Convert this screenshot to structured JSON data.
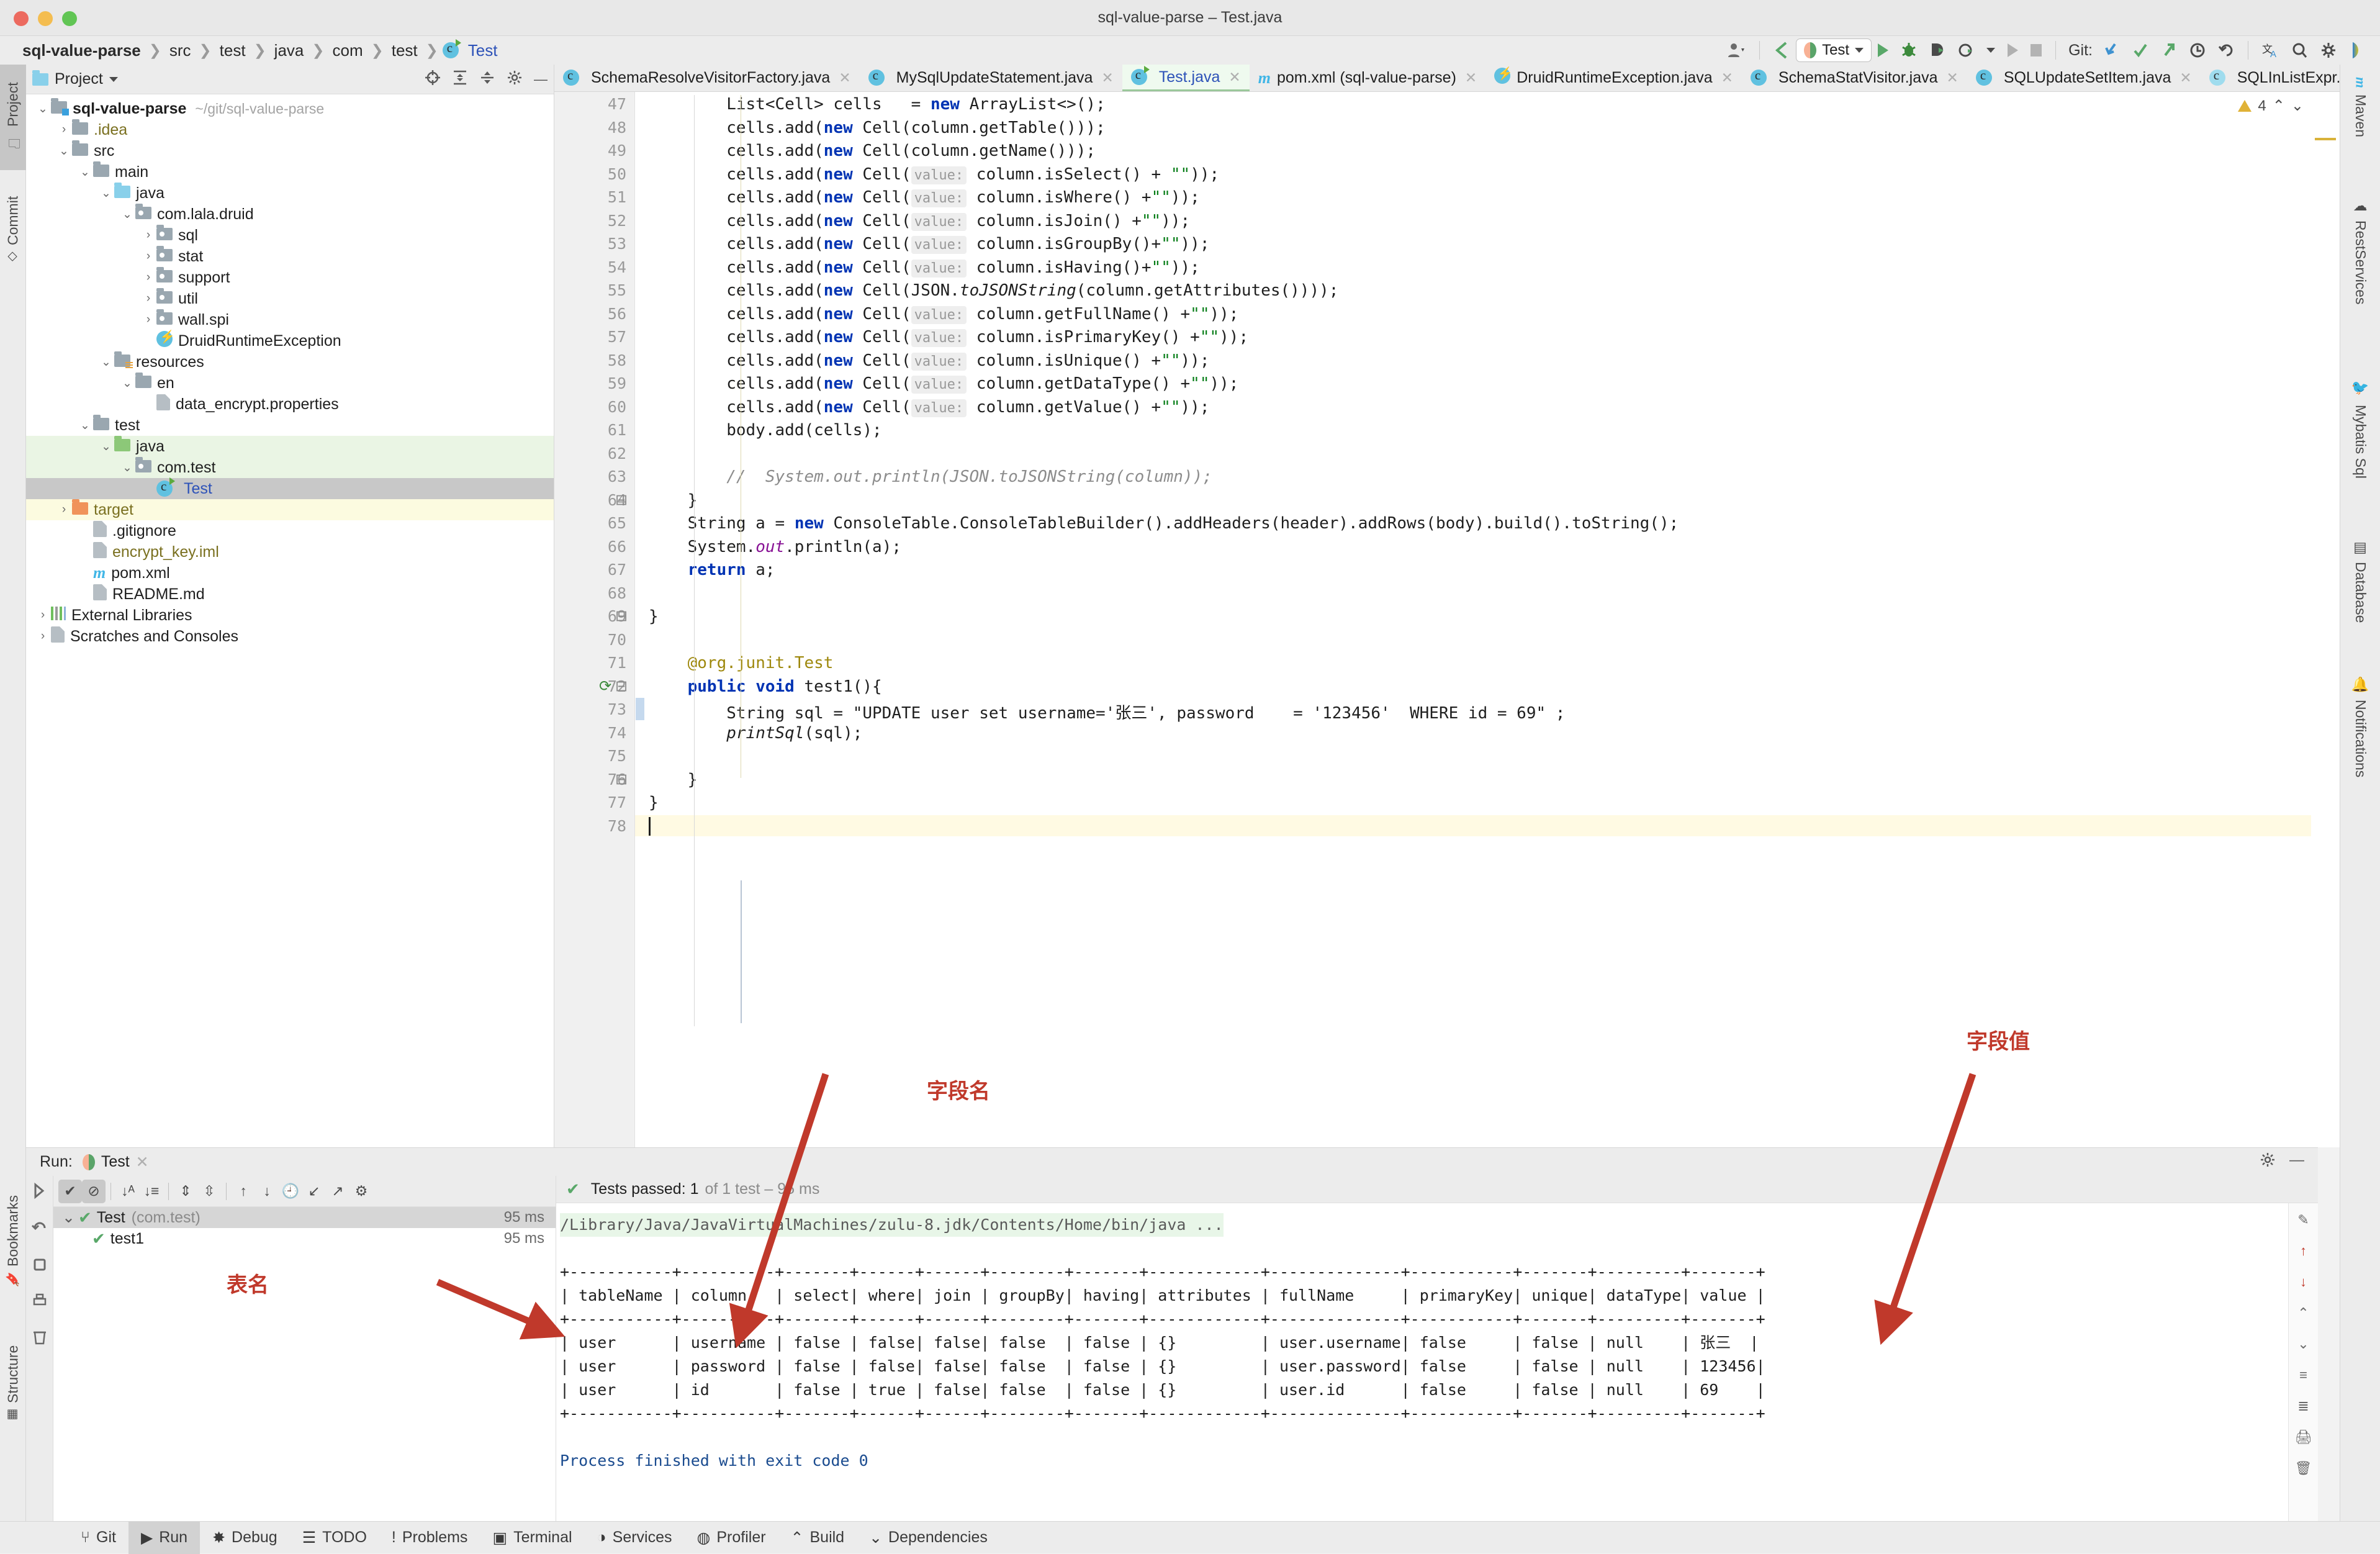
{
  "window": {
    "title": "sql-value-parse – Test.java"
  },
  "breadcrumb": {
    "items": [
      "sql-value-parse",
      "src",
      "test",
      "java",
      "com",
      "test",
      "Test"
    ]
  },
  "toolbar": {
    "run_config": "Test",
    "git_label": "Git:",
    "icons": [
      "profile-icon",
      "back-arrow-icon",
      "run-icon",
      "debug-icon",
      "coverage-icon",
      "profiler-icon",
      "rerun-icon",
      "stop-icon",
      "git-update-icon",
      "git-commit-icon",
      "git-push-icon",
      "git-history-icon",
      "git-rollback-icon",
      "translate-icon",
      "search-icon",
      "settings-icon",
      "ai-icon"
    ]
  },
  "left_tabs": [
    {
      "label": "Project",
      "selected": true
    },
    {
      "label": "Commit",
      "selected": false
    },
    {
      "label": "Bookmarks",
      "selected": false
    },
    {
      "label": "Structure",
      "selected": false
    }
  ],
  "right_tabs": [
    {
      "label": "Maven"
    },
    {
      "label": "RestServices"
    },
    {
      "label": "Mybatis Sql"
    },
    {
      "label": "Database"
    },
    {
      "label": "Notifications"
    }
  ],
  "project_panel": {
    "title": "Project",
    "tree": [
      {
        "indent": 0,
        "arrow": "v",
        "icon": "module-folder",
        "label": "sql-value-parse",
        "bold": true,
        "path": "~/git/sql-value-parse"
      },
      {
        "indent": 1,
        "arrow": ">",
        "icon": "folder",
        "label": ".idea",
        "color": "olive"
      },
      {
        "indent": 1,
        "arrow": "v",
        "icon": "folder",
        "label": "src"
      },
      {
        "indent": 2,
        "arrow": "v",
        "icon": "folder",
        "label": "main"
      },
      {
        "indent": 3,
        "arrow": "v",
        "icon": "folder-blue",
        "label": "java"
      },
      {
        "indent": 4,
        "arrow": "v",
        "icon": "package",
        "label": "com.lala.druid"
      },
      {
        "indent": 5,
        "arrow": ">",
        "icon": "package",
        "label": "sql"
      },
      {
        "indent": 5,
        "arrow": ">",
        "icon": "package",
        "label": "stat"
      },
      {
        "indent": 5,
        "arrow": ">",
        "icon": "package",
        "label": "support"
      },
      {
        "indent": 5,
        "arrow": ">",
        "icon": "package",
        "label": "util"
      },
      {
        "indent": 5,
        "arrow": ">",
        "icon": "package",
        "label": "wall.spi"
      },
      {
        "indent": 5,
        "arrow": "",
        "icon": "bolt",
        "label": "DruidRuntimeException"
      },
      {
        "indent": 3,
        "arrow": "v",
        "icon": "folder-res",
        "label": "resources"
      },
      {
        "indent": 4,
        "arrow": "v",
        "icon": "folder",
        "label": "en"
      },
      {
        "indent": 5,
        "arrow": "",
        "icon": "props-file",
        "label": "data_encrypt.properties"
      },
      {
        "indent": 2,
        "arrow": "v",
        "icon": "folder",
        "label": "test"
      },
      {
        "indent": 3,
        "arrow": "v",
        "icon": "folder-green",
        "label": "java",
        "bg": "green"
      },
      {
        "indent": 4,
        "arrow": "v",
        "icon": "package",
        "label": "com.test",
        "bg": "green"
      },
      {
        "indent": 5,
        "arrow": "",
        "icon": "class-run",
        "label": "Test",
        "color": "blue",
        "bg": "sel"
      },
      {
        "indent": 1,
        "arrow": ">",
        "icon": "folder-orange",
        "label": "target",
        "color": "olive",
        "bg": "yellow"
      },
      {
        "indent": 2,
        "arrow": "",
        "icon": "ignore-file",
        "label": ".gitignore"
      },
      {
        "indent": 2,
        "arrow": "",
        "icon": "iml-file",
        "label": "encrypt_key.iml",
        "color": "olive"
      },
      {
        "indent": 2,
        "arrow": "",
        "icon": "maven-m",
        "label": "pom.xml"
      },
      {
        "indent": 2,
        "arrow": "",
        "icon": "md-file",
        "label": "README.md"
      },
      {
        "indent": 0,
        "arrow": ">",
        "icon": "libraries",
        "label": "External Libraries"
      },
      {
        "indent": 0,
        "arrow": ">",
        "icon": "scratches",
        "label": "Scratches and Consoles"
      }
    ]
  },
  "editor_tabs": [
    {
      "label": "SchemaResolveVisitorFactory.java",
      "icon": "class-icon",
      "active": false
    },
    {
      "label": "MySqlUpdateStatement.java",
      "icon": "class-icon",
      "active": false
    },
    {
      "label": "Test.java",
      "icon": "class-run-icon",
      "active": true
    },
    {
      "label": "pom.xml (sql-value-parse)",
      "icon": "maven-icon",
      "active": false
    },
    {
      "label": "DruidRuntimeException.java",
      "icon": "bolt-icon",
      "active": false
    },
    {
      "label": "SchemaStatVisitor.java",
      "icon": "class-icon",
      "active": false
    },
    {
      "label": "SQLUpdateSetItem.java",
      "icon": "class-icon",
      "active": false
    },
    {
      "label": "SQLInListExpr.java",
      "icon": "abstract-class-icon",
      "active": false
    }
  ],
  "editor": {
    "warning_count": "4",
    "first_visible_line": 47,
    "lines": [
      {
        "n": 47,
        "text": "        List<Cell> cells   = new ArrayList<>();"
      },
      {
        "n": 48,
        "text": "        cells.add(new Cell(column.getTable()));"
      },
      {
        "n": 49,
        "text": "        cells.add(new Cell(column.getName()));"
      },
      {
        "n": 50,
        "text": "        cells.add(new Cell( value: column.isSelect() + \"\"));"
      },
      {
        "n": 51,
        "text": "        cells.add(new Cell( value: column.isWhere() +\"\"));"
      },
      {
        "n": 52,
        "text": "        cells.add(new Cell( value: column.isJoin() +\"\"));"
      },
      {
        "n": 53,
        "text": "        cells.add(new Cell( value: column.isGroupBy()+\"\"));"
      },
      {
        "n": 54,
        "text": "        cells.add(new Cell( value: column.isHaving()+\"\"));"
      },
      {
        "n": 55,
        "text": "        cells.add(new Cell(JSON.toJSONString(column.getAttributes())));"
      },
      {
        "n": 56,
        "text": "        cells.add(new Cell( value: column.getFullName() +\"\"));"
      },
      {
        "n": 57,
        "text": "        cells.add(new Cell( value: column.isPrimaryKey() +\"\"));"
      },
      {
        "n": 58,
        "text": "        cells.add(new Cell( value: column.isUnique() +\"\"));"
      },
      {
        "n": 59,
        "text": "        cells.add(new Cell( value: column.getDataType() +\"\"));"
      },
      {
        "n": 60,
        "text": "        cells.add(new Cell( value: column.getValue() +\"\"));"
      },
      {
        "n": 61,
        "text": "        body.add(cells);"
      },
      {
        "n": 62,
        "text": ""
      },
      {
        "n": 63,
        "text": "        //  System.out.println(JSON.toJSONString(column));"
      },
      {
        "n": 64,
        "text": "    }"
      },
      {
        "n": 65,
        "text": "    String a = new ConsoleTable.ConsoleTableBuilder().addHeaders(header).addRows(body).build().toString();"
      },
      {
        "n": 66,
        "text": "    System.out.println(a);"
      },
      {
        "n": 67,
        "text": "    return a;"
      },
      {
        "n": 68,
        "text": ""
      },
      {
        "n": 69,
        "text": "}"
      },
      {
        "n": 70,
        "text": ""
      },
      {
        "n": 71,
        "text": "    @org.junit.Test"
      },
      {
        "n": 72,
        "text": "    public void test1(){"
      },
      {
        "n": 73,
        "text": "        String sql = \"UPDATE user set username='张三', password    = '123456'  WHERE id = 69\" ;"
      },
      {
        "n": 74,
        "text": "        printSql(sql);"
      },
      {
        "n": 75,
        "text": ""
      },
      {
        "n": 76,
        "text": "    }"
      },
      {
        "n": 77,
        "text": "}"
      },
      {
        "n": 78,
        "text": ""
      }
    ]
  },
  "annotations": [
    {
      "text": "字段名",
      "name": "annotation-field-name"
    },
    {
      "text": "字段值",
      "name": "annotation-field-value"
    },
    {
      "text": "表名",
      "name": "annotation-table-name"
    }
  ],
  "run_panel": {
    "label": "Run:",
    "tab": "Test",
    "status": {
      "prefix": "Tests passed: 1",
      "suffix": "of 1 test – 95 ms"
    },
    "tests": [
      {
        "label": "Test",
        "pkg": "(com.test)",
        "time": "95 ms",
        "selected": true,
        "arrow": "v"
      },
      {
        "label": "test1",
        "pkg": "",
        "time": "95 ms",
        "selected": false,
        "arrow": ""
      }
    ],
    "console": {
      "command": "/Library/Java/JavaVirtualMachines/zulu-8.jdk/Contents/Home/bin/java ...",
      "exit_line": "Process finished with exit code 0",
      "table": {
        "headers": [
          "tableName",
          "column",
          "select",
          "where",
          "join",
          "groupBy",
          "having",
          "attributes",
          "fullName",
          "primaryKey",
          "unique",
          "dataType",
          "value"
        ],
        "rows": [
          [
            "user",
            "username",
            "false",
            "false",
            "false",
            "false",
            "false",
            "{}",
            "user.username",
            "false",
            "false",
            "null",
            "张三"
          ],
          [
            "user",
            "password",
            "false",
            "false",
            "false",
            "false",
            "false",
            "{}",
            "user.password",
            "false",
            "false",
            "null",
            "123456"
          ],
          [
            "user",
            "id",
            "false",
            "true",
            "false",
            "false",
            "false",
            "{}",
            "user.id",
            "false",
            "false",
            "null",
            "69"
          ]
        ],
        "widths": [
          11,
          10,
          7,
          6,
          6,
          8,
          7,
          12,
          14,
          11,
          7,
          9,
          7
        ]
      }
    }
  },
  "status_bar": {
    "items": [
      {
        "label": "Git",
        "icon": "git-branch-icon",
        "selected": false
      },
      {
        "label": "Run",
        "icon": "run-icon",
        "selected": true
      },
      {
        "label": "Debug",
        "icon": "debug-icon",
        "selected": false
      },
      {
        "label": "TODO",
        "icon": "todo-icon",
        "selected": false
      },
      {
        "label": "Problems",
        "icon": "problems-icon",
        "selected": false
      },
      {
        "label": "Terminal",
        "icon": "terminal-icon",
        "selected": false
      },
      {
        "label": "Services",
        "icon": "services-icon",
        "selected": false
      },
      {
        "label": "Profiler",
        "icon": "profiler-icon",
        "selected": false
      },
      {
        "label": "Build",
        "icon": "build-icon",
        "selected": false
      },
      {
        "label": "Dependencies",
        "icon": "dependencies-icon",
        "selected": false
      }
    ]
  },
  "colors": {
    "accent_blue": "#2d52b8",
    "string_green": "#067d17",
    "keyword_blue": "#0033b3",
    "annotation_red": "#c0392b",
    "pass_green": "#59a869"
  }
}
